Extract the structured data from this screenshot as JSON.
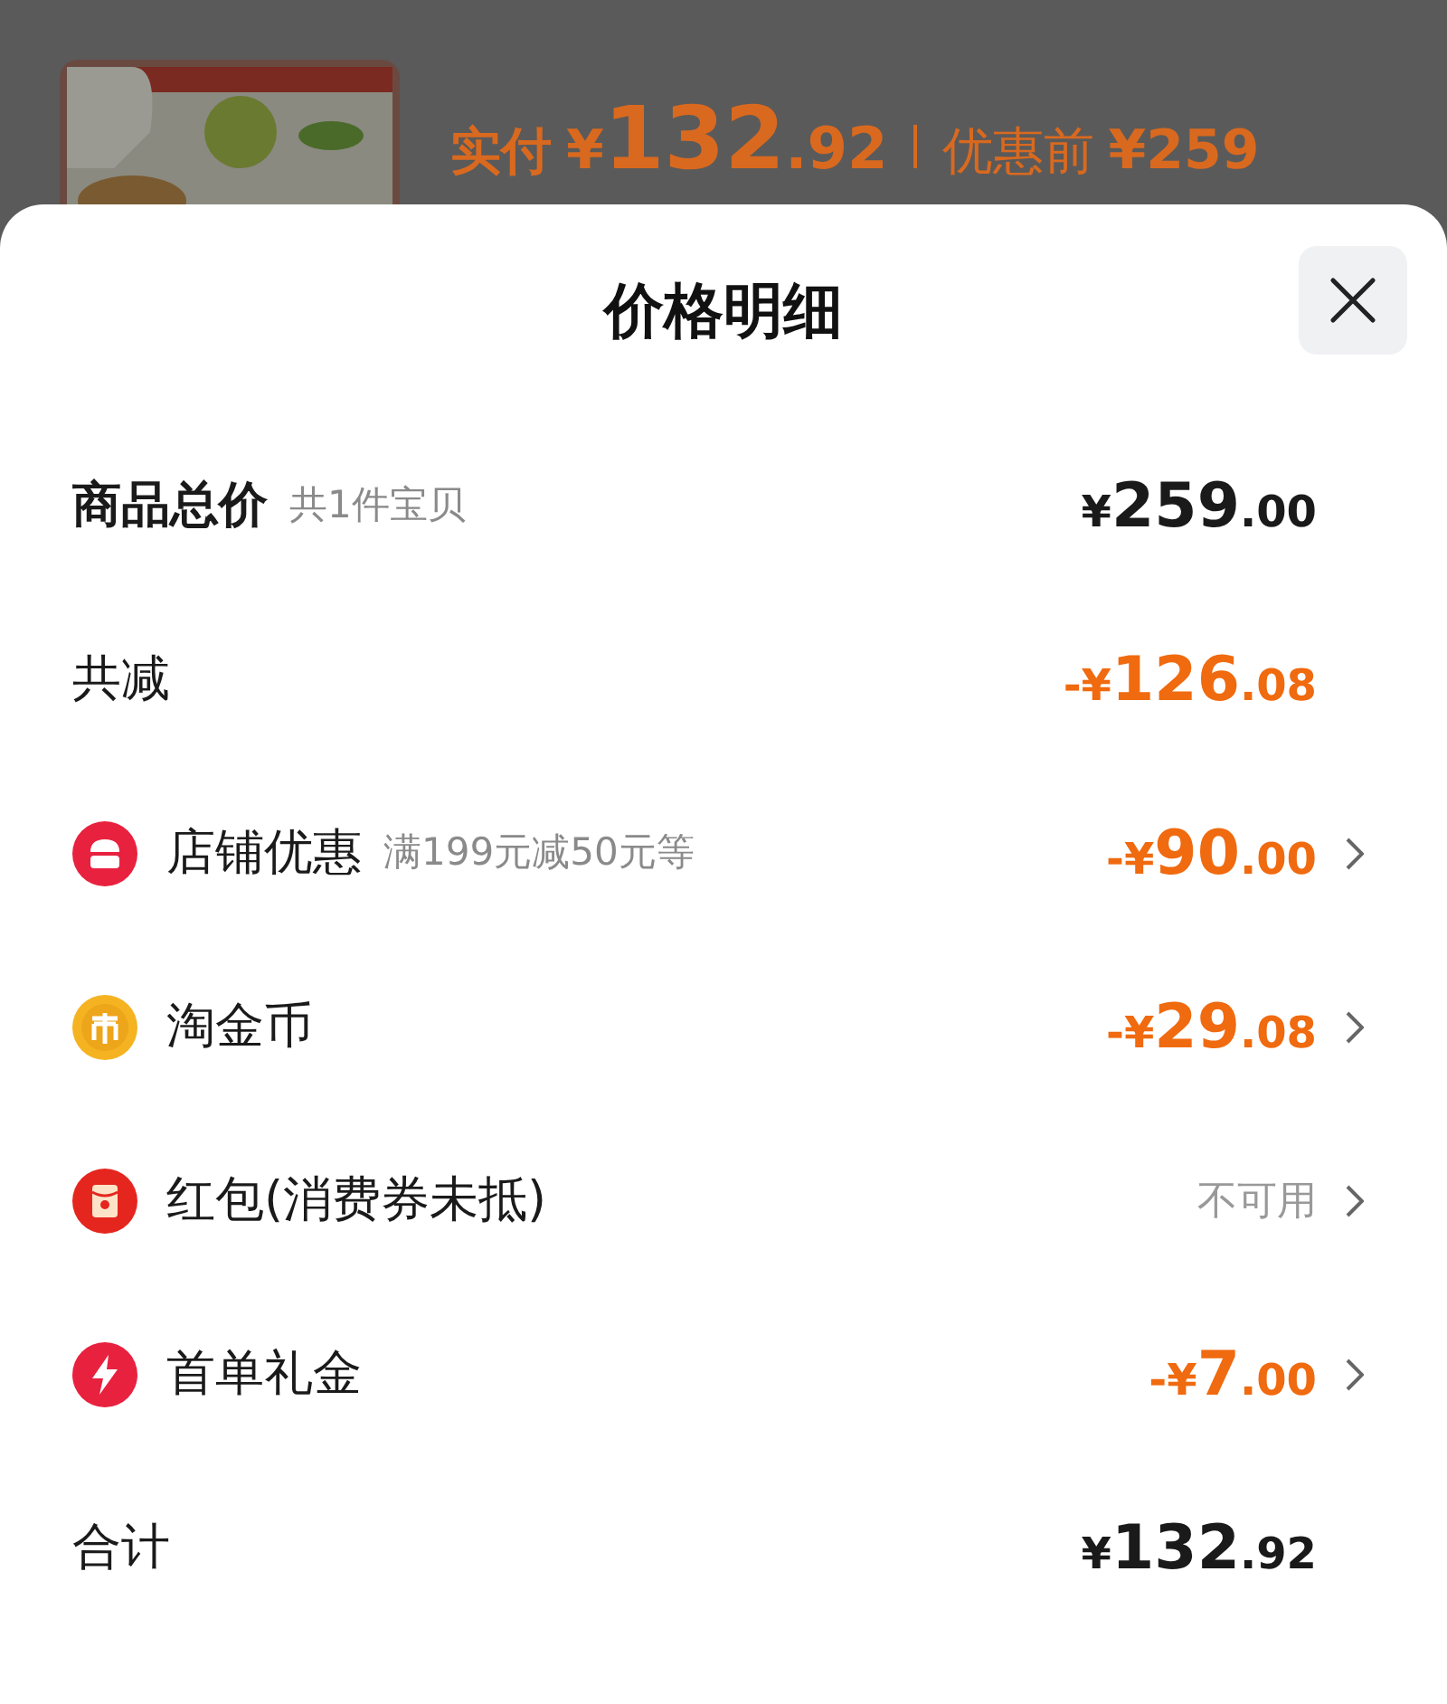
{
  "background": {
    "paid_label": "实付",
    "paid_symbol": "¥",
    "paid_whole": "132",
    "paid_fraction": ".92",
    "original_label": "优惠前",
    "original_price": "¥259"
  },
  "sheet": {
    "title": "价格明细",
    "rows": [
      {
        "kind": "plain",
        "label": "商品总价",
        "note": "共1件宝贝",
        "color": "#1a1a1a",
        "symbol": "¥",
        "whole": "259",
        "fraction": ".00",
        "arrow": false
      },
      {
        "kind": "plain",
        "label": "共减",
        "color": "#f06a0f",
        "symbol": "-¥",
        "whole": "126",
        "fraction": ".08",
        "arrow": false
      },
      {
        "kind": "shop",
        "label": "店铺优惠",
        "note": "满199元减50元等",
        "color": "#f06a0f",
        "symbol": "-¥",
        "whole": "90",
        "fraction": ".00",
        "arrow": true
      },
      {
        "kind": "coin",
        "label": "淘金币",
        "color": "#f06a0f",
        "symbol": "-¥",
        "whole": "29",
        "fraction": ".08",
        "arrow": true
      },
      {
        "kind": "envelope",
        "label": "红包(消费券未抵)",
        "color": "#999999",
        "status": "不可用",
        "arrow": true
      },
      {
        "kind": "bolt",
        "label": "首单礼金",
        "color": "#f06a0f",
        "symbol": "-¥",
        "whole": "7",
        "fraction": ".00",
        "arrow": true
      },
      {
        "kind": "plain",
        "label": "合计",
        "color": "#1a1a1a",
        "symbol": "¥",
        "whole": "132",
        "fraction": ".92",
        "arrow": false
      }
    ]
  }
}
